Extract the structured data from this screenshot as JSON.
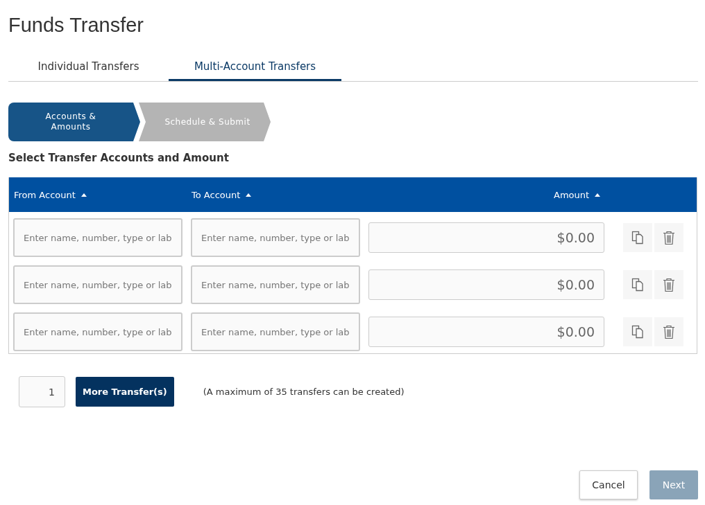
{
  "title": "Funds Transfer",
  "tabs": [
    {
      "label": "Individual Transfers",
      "selected": false
    },
    {
      "label": "Multi-Account Transfers",
      "selected": true
    }
  ],
  "steps": [
    {
      "label": "Accounts & Amounts",
      "selected": true
    },
    {
      "label": "Schedule & Submit",
      "selected": false
    }
  ],
  "section_title": "Select Transfer Accounts and Amount",
  "table": {
    "columns": [
      {
        "label": "From Account",
        "sorted_ascending": true
      },
      {
        "label": "To Account",
        "sorted_ascending": true
      },
      {
        "label": "Amount",
        "sorted_ascending": true
      }
    ],
    "rows": [
      {
        "from_placeholder": "Enter name, number, type or lab",
        "to_placeholder": "Enter name, number, type or lab",
        "amount": "$0.00"
      },
      {
        "from_placeholder": "Enter name, number, type or lab",
        "to_placeholder": "Enter name, number, type or lab",
        "amount": "$0.00"
      },
      {
        "from_placeholder": "Enter name, number, type or lab",
        "to_placeholder": "Enter name, number, type or lab",
        "amount": "$0.00"
      }
    ]
  },
  "add": {
    "count": "1",
    "button": "More Transfer(s)",
    "note": "(A maximum of 35 transfers can be created)"
  },
  "buttons": [
    {
      "label": "Cancel",
      "kind": "secondary",
      "disabled": false
    },
    {
      "label": "Next",
      "kind": "primary",
      "disabled": true
    }
  ]
}
